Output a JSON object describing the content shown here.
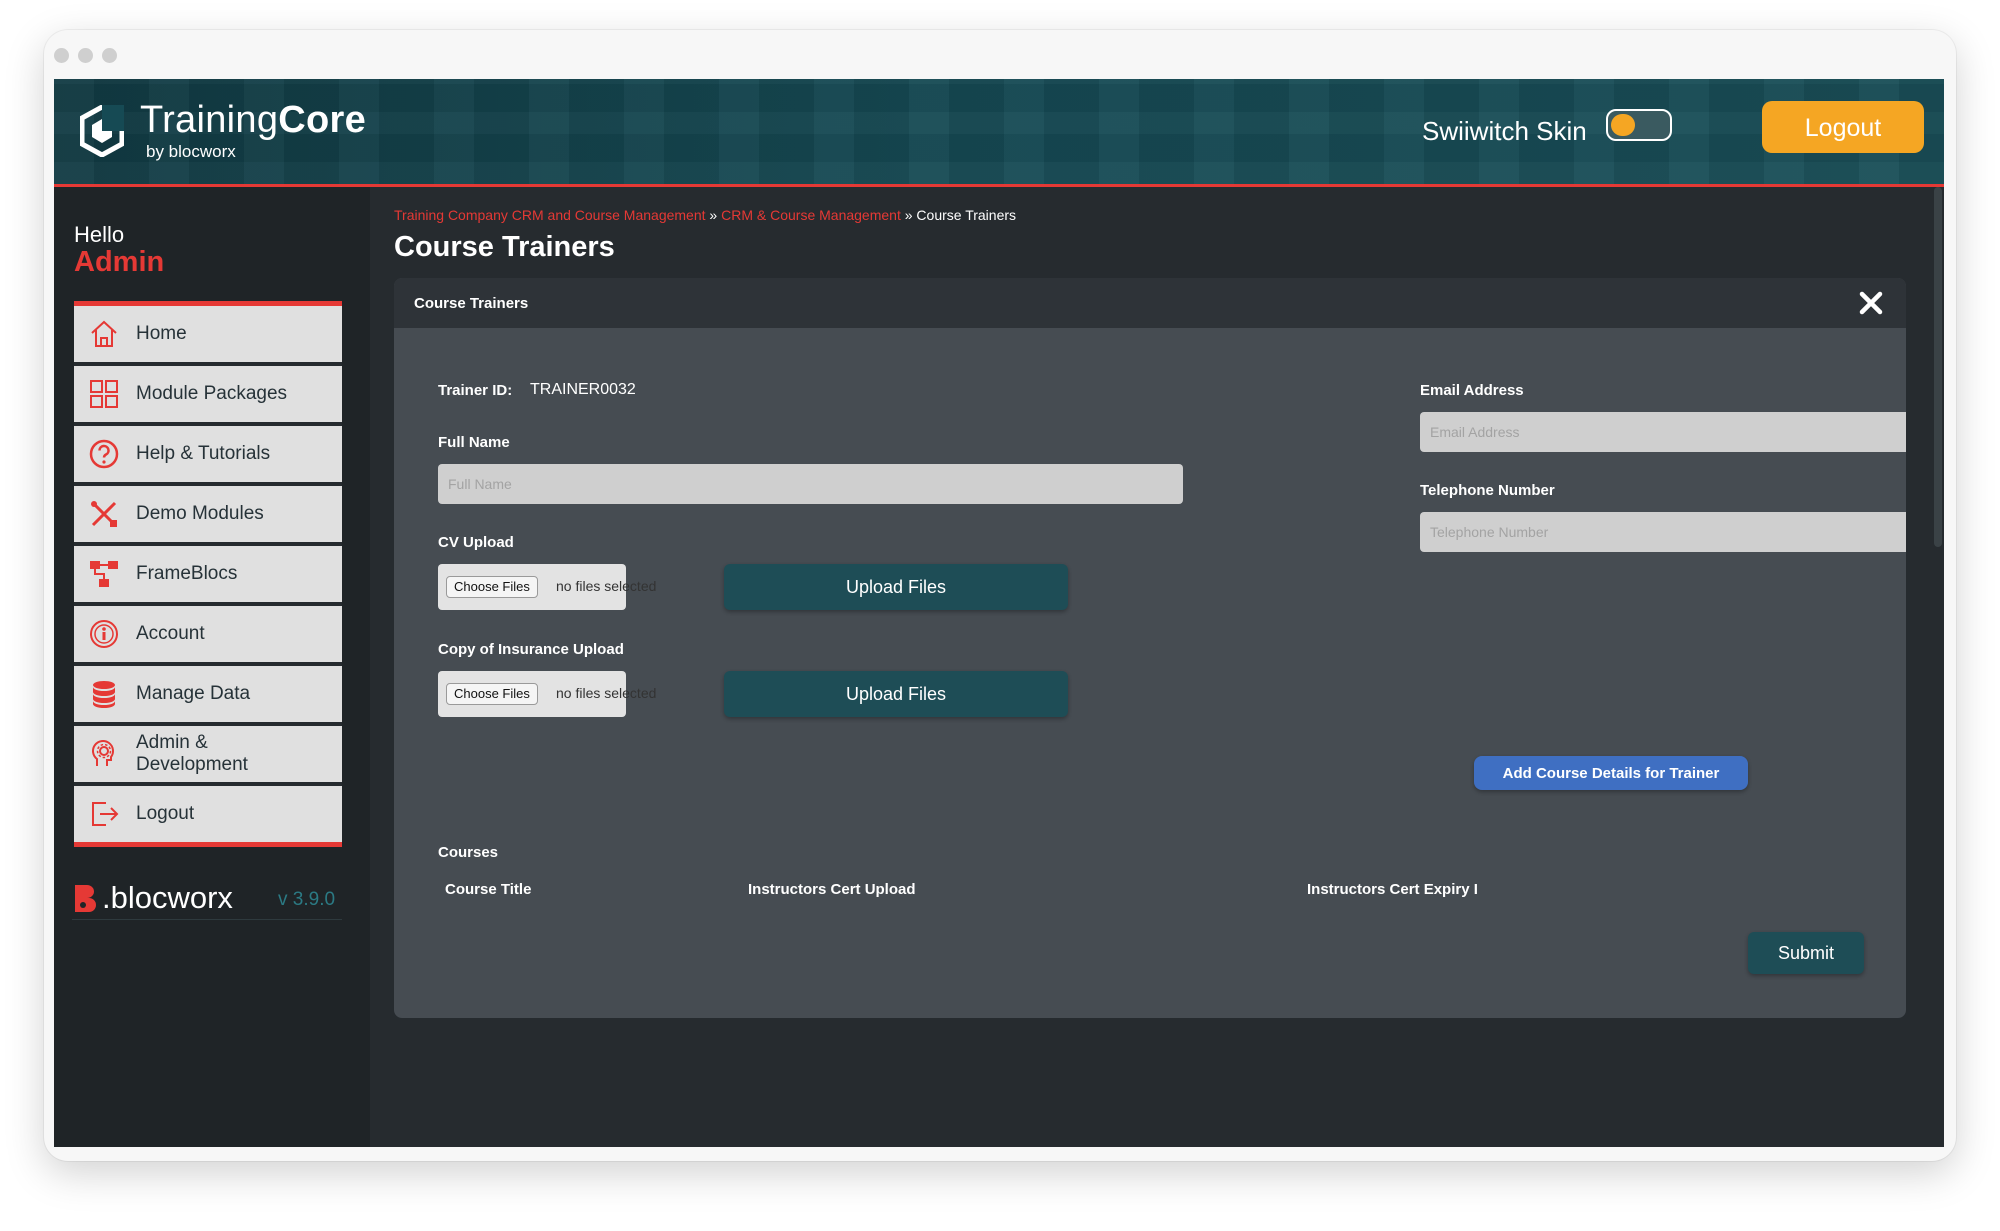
{
  "header": {
    "brand_light": "Training",
    "brand_bold": "Core",
    "brand_sub": "by blocworx",
    "skin_label": "Swiiwitch Skin",
    "logout_label": "Logout"
  },
  "sidebar": {
    "hello": "Hello",
    "user": "Admin",
    "items": [
      {
        "label": "Home",
        "icon": "home-icon"
      },
      {
        "label": "Module Packages",
        "icon": "grid-icon"
      },
      {
        "label": "Help & Tutorials",
        "icon": "help-icon"
      },
      {
        "label": "Demo Modules",
        "icon": "tools-icon"
      },
      {
        "label": "FrameBlocs",
        "icon": "hierarchy-icon"
      },
      {
        "label": "Account",
        "icon": "account-icon"
      },
      {
        "label": "Manage Data",
        "icon": "database-icon"
      },
      {
        "label": "Admin & Development",
        "icon": "admin-gear-icon"
      },
      {
        "label": "Logout",
        "icon": "logout-icon"
      }
    ],
    "footer_brand": ".blocworx",
    "version": "v 3.9.0"
  },
  "breadcrumb": {
    "items": [
      "Training Company CRM and Course Management",
      "CRM & Course Management",
      "Course Trainers"
    ],
    "separator": "»"
  },
  "page_title": "Course Trainers",
  "panel": {
    "title": "Course Trainers",
    "trainer_id_label": "Trainer ID:",
    "trainer_id_value": "TRAINER0032",
    "full_name_label": "Full Name",
    "full_name_placeholder": "Full Name",
    "email_label": "Email Address",
    "email_placeholder": "Email Address",
    "phone_label": "Telephone Number",
    "phone_placeholder": "Telephone Number",
    "cv_label": "CV Upload",
    "insurance_label": "Copy of Insurance Upload",
    "choose_files": "Choose Files",
    "no_files": "no files selected",
    "upload_label": "Upload Files",
    "add_course_label": "Add Course Details for Trainer",
    "courses_label": "Courses",
    "columns": [
      "Course Title",
      "Instructors Cert Upload",
      "Instructors Cert Expiry I"
    ],
    "submit_label": "Submit"
  },
  "colors": {
    "accent_red": "#e53935",
    "accent_orange": "#f5a623",
    "teal_button": "#1e4d56",
    "blue_button": "#3f6fc2"
  }
}
